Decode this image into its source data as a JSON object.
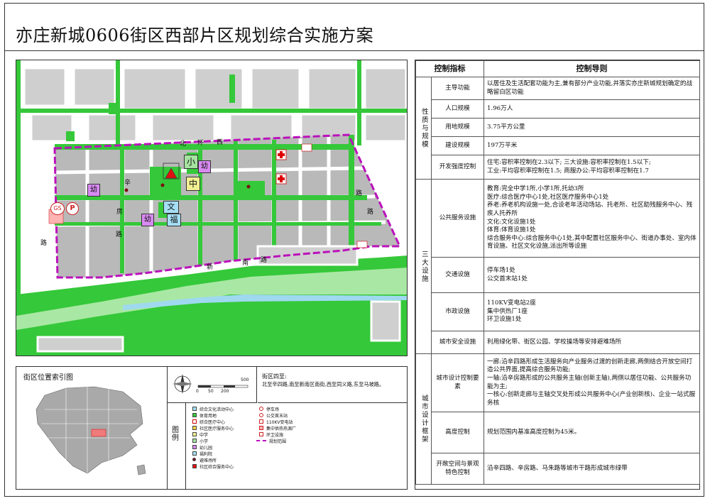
{
  "title": "亦庄新城0606街区西部片区规划综合实施方案",
  "map": {
    "road_labels": [
      "北",
      "环",
      "西",
      "路",
      "辛",
      "房",
      "路",
      "新",
      "南",
      "路",
      "路",
      "路"
    ],
    "facility_icons": [
      {
        "label": "小",
        "name": "primary-school-icon"
      },
      {
        "label": "幼",
        "name": "kindergarten-icon"
      },
      {
        "label": "中",
        "name": "middle-school-icon"
      },
      {
        "label": "文",
        "name": "culture-facility-icon"
      },
      {
        "label": "福",
        "name": "welfare-home-icon"
      },
      {
        "label": "P",
        "name": "parking-icon"
      },
      {
        "label": "GS",
        "name": "gas-station-icon"
      }
    ],
    "colors": {
      "green": "#35c83a",
      "lightgreen": "#a9e8a4",
      "grey": "#b9b9b9",
      "white_roads": "#ffffff",
      "boundary": "#bb11bb",
      "water": "#9fd9ef"
    }
  },
  "index_map": {
    "title": "街区位置索引图",
    "scale_labels": [
      "0",
      "50",
      "200",
      "500"
    ],
    "scope_title": "街区四至:",
    "scope_text": "北至辛四路,南至新南区南街,西至同义路,东至马坡路。",
    "legend_label": "图    例",
    "legend_items": [
      "综合文化活动中心",
      "体育用地",
      "综合医疗中心",
      "社区医疗服务中心",
      "中学",
      "小学",
      "幼儿园",
      "福利院",
      "避难场所",
      "社区综合服务中心",
      "停车场",
      "公交首末站",
      "110KV变电站",
      "集中供热热源厂",
      "环卫设施",
      "规划范围"
    ]
  },
  "control_table": {
    "headers": [
      "控制指标",
      "控制导则"
    ],
    "groups": {
      "g1": "性质与规模",
      "g2": "三大设施",
      "g3": "城市设计框架"
    },
    "rows": {
      "r1": {
        "ind": "主导功能",
        "text": "以居住及生活配套功能为主,兼有部分产业功能,并落实亦庄新城规划确定的战略留白区功能"
      },
      "r2": {
        "ind": "人口规模",
        "text": "1.96万人"
      },
      "r3": {
        "ind": "用地规模",
        "text": "3.75平方公里"
      },
      "r4": {
        "ind": "建设规模",
        "text": "197万平米"
      },
      "r5": {
        "ind": "开发强度控制",
        "line1": "住宅:容积率控制在2.3以下;   三大设施:容积率控制在1.5以下;",
        "line2": "工业:平均容积率控制在1.5;   商服办公:平均容积率控制在1.7"
      },
      "r6": {
        "ind": "公共服务设施",
        "lines": [
          "教育:完全中学1所,小学1所,托幼3所",
          "医疗:综合医疗中心1处,社区医疗服务中心1处",
          "养老:养老机构设施一处,合设老年活动场站、托老所、社区助残服务中心、残疾人托养所",
          "文化:文化设施1处",
          "体育:体育设施1处",
          "综合服务中心:综合服务中心1处,其中配置社区服务中心、街道办事处、室内体育设施、社区文化设施,派出所等设施"
        ]
      },
      "r7": {
        "ind": "交通设施",
        "lines": [
          "停车场1处",
          "公交首末站1处"
        ]
      },
      "r8": {
        "ind": "市政设施",
        "lines": [
          "110KV变电站2座",
          "集中供热厂1座",
          "环卫设施1处"
        ]
      },
      "r9": {
        "ind": "城市安全设施",
        "text": "利用绿化带、街区公园、学校操场等安排避难场所"
      },
      "r10": {
        "ind": "城市设计控制要素",
        "lines": [
          "一廊:沿辛四路形成生活服务向产业服务过渡的创新走廊,两侧结合开放空间打造公共界面,提高综合服务功能;",
          "一轴:沿辛房路形成的公共服务主轴(创新主轴),两侧以居住功能、公共服务功能为主;",
          "一核心:创新走廊与主轴交叉处形成公共服务中心(产业创新核)、企业一站式服务核"
        ]
      },
      "r11": {
        "ind": "高度控制",
        "text": "规划范围内基准高度控制为45米。"
      },
      "r12": {
        "ind": "开敞空间与景观特色控制",
        "text": "沿辛四路、辛房路、马朱路等城市干路形成城市绿带"
      }
    }
  }
}
